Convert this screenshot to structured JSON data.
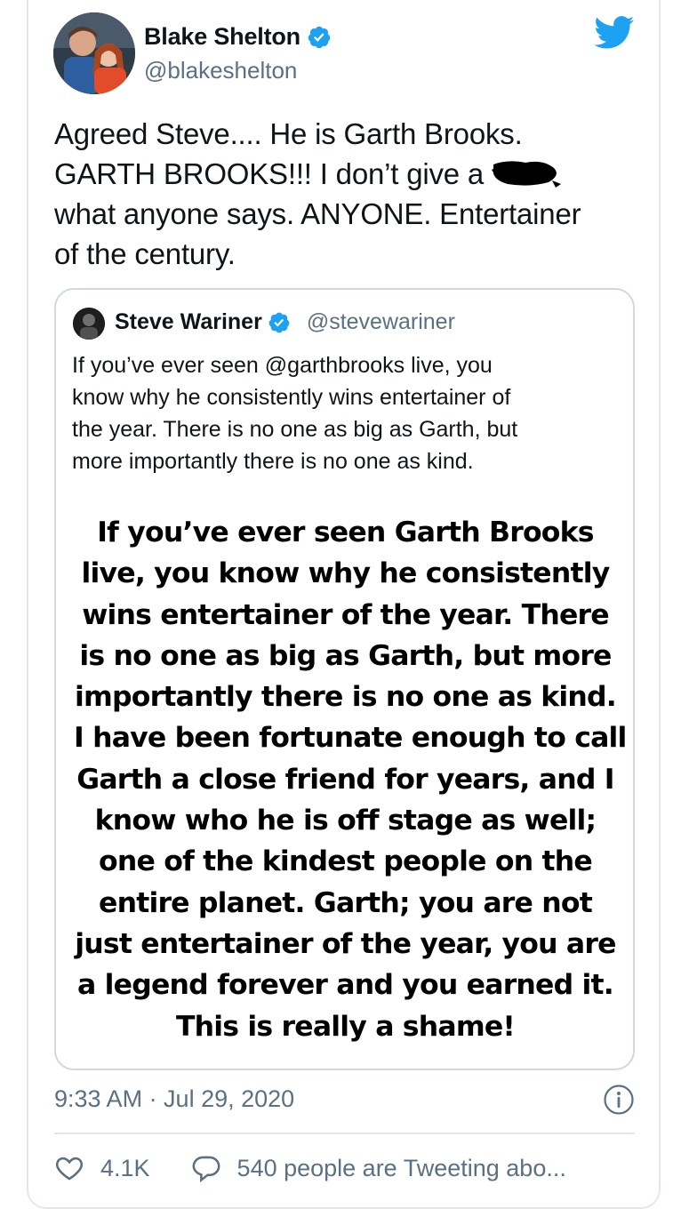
{
  "tweet": {
    "author_name": "Blake Shelton",
    "author_handle": "@blakeshelton",
    "text_lines": [
      "Agreed Steve.... He is Garth Brooks.",
      "GARTH BROOKS!!! I don’t give a ",
      "what anyone says. ANYONE. Entertainer",
      "of the century."
    ],
    "timestamp": "9:33 AM · Jul 29, 2020",
    "like_count": "4.1K",
    "reply_text": "540 people are Tweeting abo...",
    "icons": {
      "brand": "twitter-bird-icon",
      "verified": "verified-badge-icon",
      "info": "info-icon",
      "like": "heart-icon",
      "reply": "speech-bubble-icon"
    },
    "colors": {
      "twitter_blue": "#1da1f2",
      "secondary_text": "#5b7083",
      "border": "#e1e8ed"
    }
  },
  "quoted": {
    "author_name": "Steve Wariner",
    "author_handle": "@stevewariner",
    "text_lines": [
      "If you’ve ever seen @garthbrooks live, you",
      "know why he consistently wins entertainer of",
      "the year. There is no one as big as Garth, but",
      "more importantly there is no one as kind."
    ],
    "image_text_lines": [
      "If you’ve ever seen Garth Brooks",
      "live, you know why he consistently",
      "wins entertainer of the year. There",
      "is no one as big as Garth, but more",
      "importantly there is no one as kind.",
      "I have been fortunate enough to call",
      "Garth a close friend for years, and I",
      "know who he is off stage as well;",
      "one of the kindest people on the",
      "entire planet. Garth; you are not",
      "just entertainer of the year, you are",
      "a legend forever and you earned it.",
      "This is really a shame!"
    ]
  }
}
